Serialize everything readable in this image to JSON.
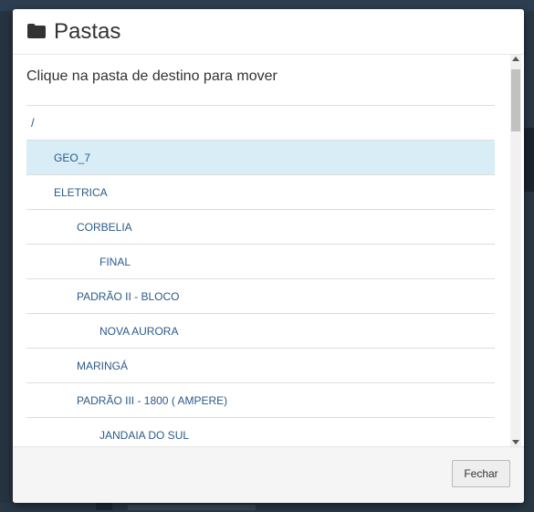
{
  "modal": {
    "title": "Pastas",
    "instruction": "Clique na pasta de destino para mover",
    "close_label": "Fechar"
  },
  "folders": [
    {
      "label": "/",
      "level": 0,
      "selected": false
    },
    {
      "label": "GEO_7",
      "level": 1,
      "selected": true
    },
    {
      "label": "ELETRICA",
      "level": 1,
      "selected": false
    },
    {
      "label": "CORBELIA",
      "level": 2,
      "selected": false
    },
    {
      "label": "FINAL",
      "level": 3,
      "selected": false
    },
    {
      "label": "PADRÃO II - BLOCO",
      "level": 2,
      "selected": false
    },
    {
      "label": "NOVA AURORA",
      "level": 3,
      "selected": false
    },
    {
      "label": "MARINGÁ",
      "level": 2,
      "selected": false
    },
    {
      "label": "PADRÃO III - 1800 ( AMPERE)",
      "level": 2,
      "selected": false
    },
    {
      "label": "JANDAIA DO SUL",
      "level": 3,
      "selected": false
    }
  ],
  "icons": {
    "header": "folder-icon"
  },
  "colors": {
    "selected_row": "#d9edf7",
    "link": "#2a5a8a"
  }
}
